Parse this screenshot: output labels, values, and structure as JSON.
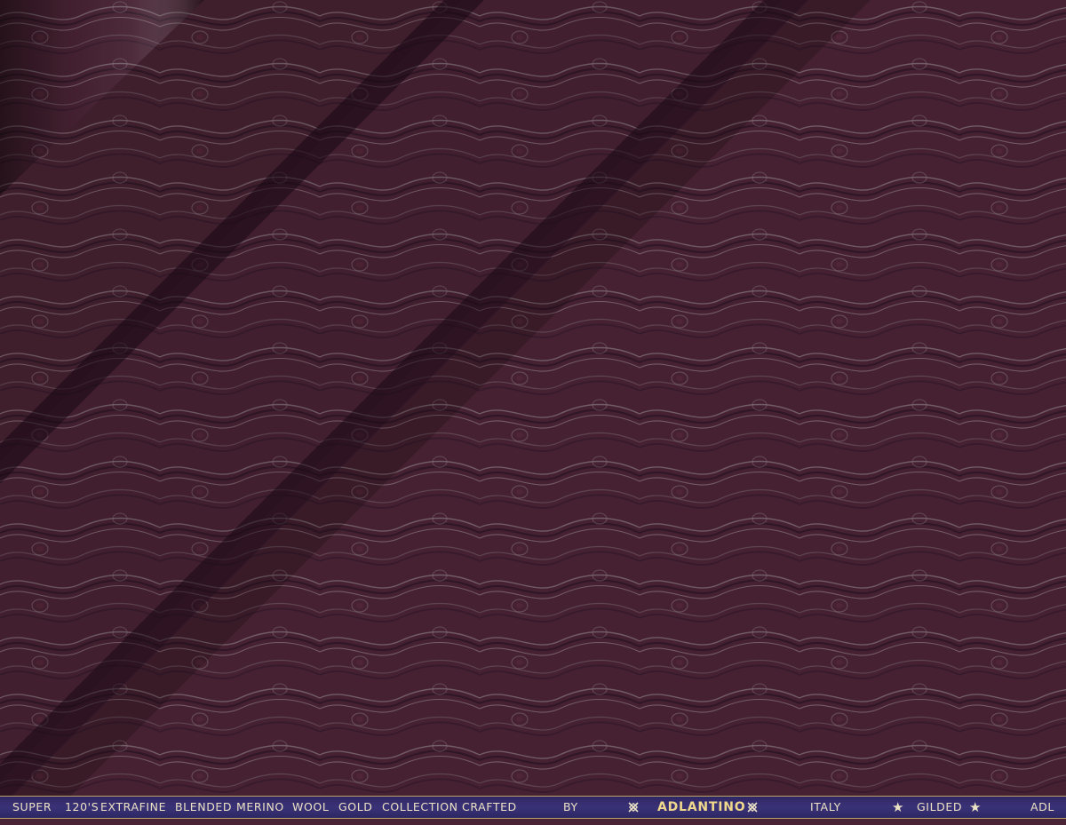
{
  "scene": {
    "subject": "folded-fabric-swatch",
    "colors": {
      "base": "#4a2434",
      "pattern_light": "#9a8a8e",
      "pattern_dark": "#2a1524",
      "fold_shadow": "#1a0a14",
      "selvedge_bg": "#332b6e",
      "selvedge_text": "#ece2c4",
      "selvedge_border": "#b9a56a"
    }
  },
  "selvedge": {
    "words": [
      "SUPER",
      "120'S",
      "EXTRAFINE",
      "BLENDED",
      "MERINO",
      "WOOL",
      "GOLD",
      "COLLECTION",
      "CRAFTED",
      "BY"
    ],
    "brand": "ADLANTINO",
    "origin": "ITALY",
    "tagline": "GILDED",
    "suffix": "ADL",
    "knot_icon": "knot-icon",
    "star_icon": "star-icon"
  }
}
